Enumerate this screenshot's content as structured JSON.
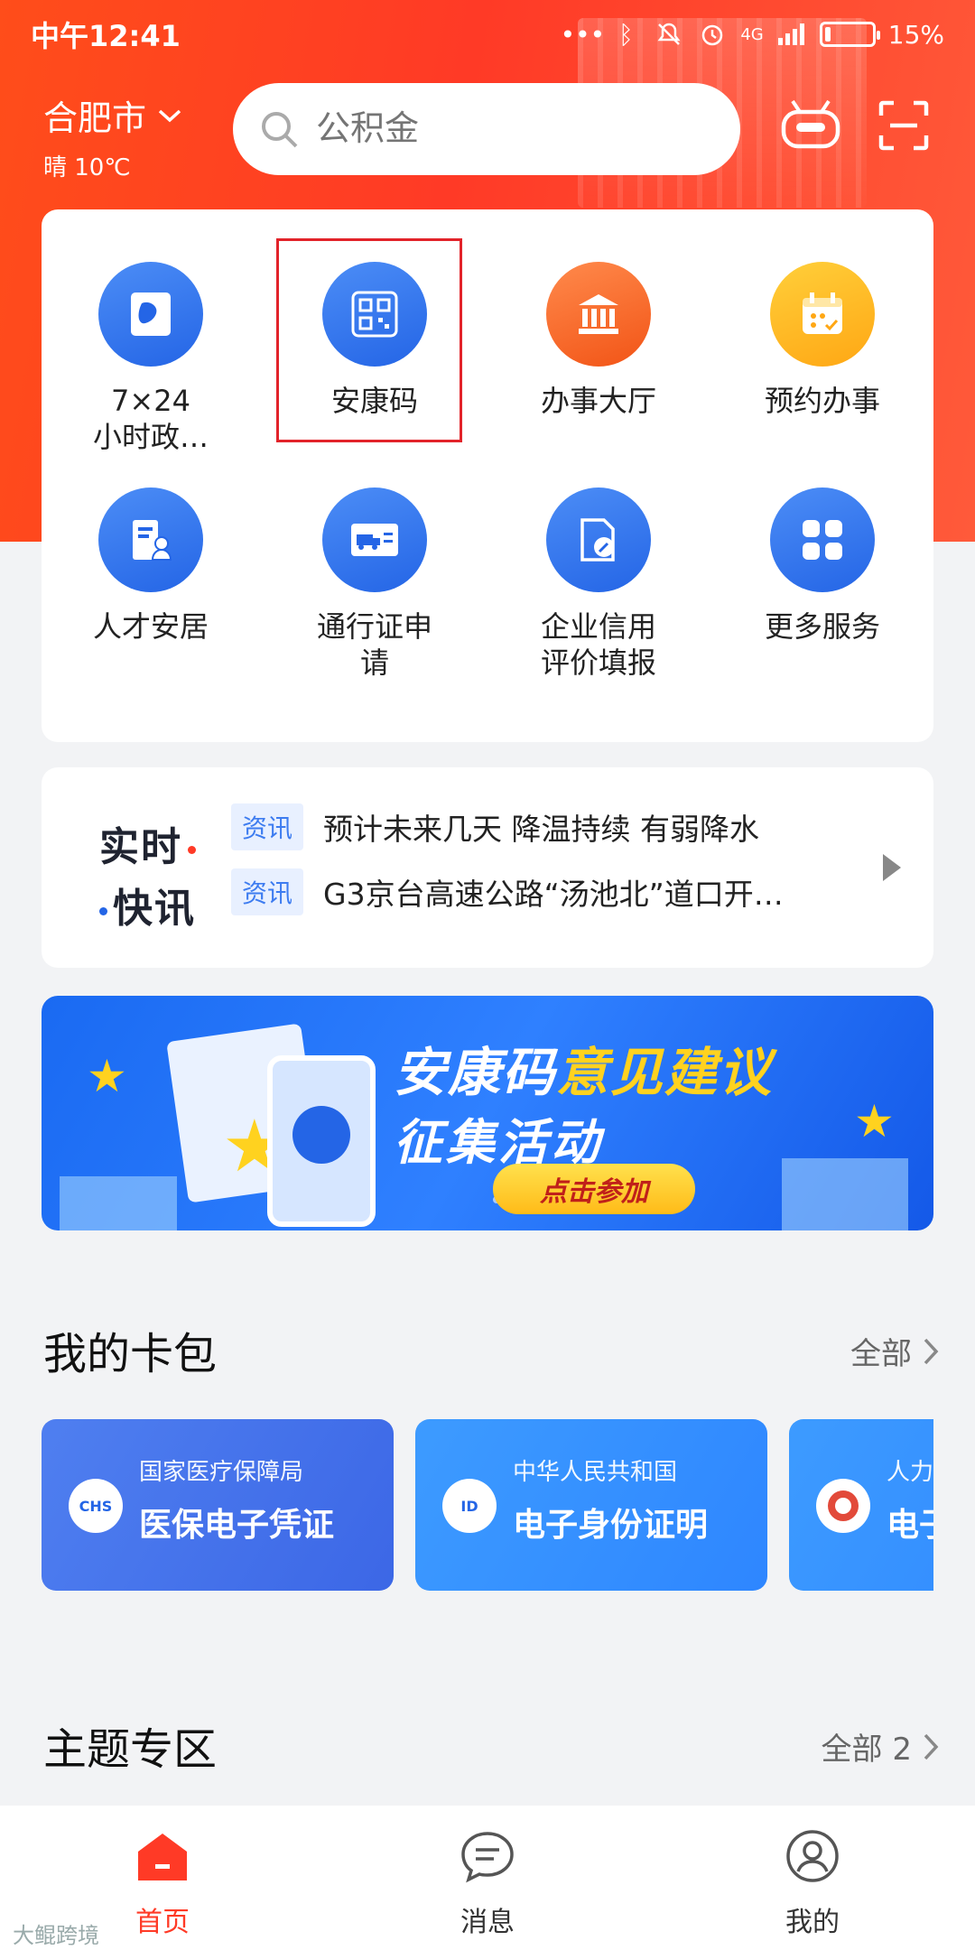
{
  "status_bar": {
    "time": "中午12:41",
    "network": "4G",
    "battery_pct": 15,
    "battery_label": "15%"
  },
  "header": {
    "city": "合肥市",
    "weather": "晴 10℃",
    "search_placeholder": "公积金"
  },
  "services": [
    {
      "label": "7×24\n小时政…",
      "icon": "map-doc-icon",
      "color": "blue"
    },
    {
      "label": "安康码",
      "icon": "qr-code-icon",
      "color": "blue",
      "highlighted": true
    },
    {
      "label": "办事大厅",
      "icon": "government-hall-icon",
      "color": "orange"
    },
    {
      "label": "预约办事",
      "icon": "calendar-icon",
      "color": "yellow"
    },
    {
      "label": "人才安居",
      "icon": "person-doc-icon",
      "color": "blue"
    },
    {
      "label": "通行证申\n请",
      "icon": "truck-pass-icon",
      "color": "blue"
    },
    {
      "label": "企业信用\n评价填报",
      "icon": "edit-doc-icon",
      "color": "blue"
    },
    {
      "label": "更多服务",
      "icon": "grid-icon",
      "color": "blue"
    }
  ],
  "news": {
    "logo_line1": "实时",
    "logo_line2": "快讯",
    "items": [
      {
        "tag": "资讯",
        "text": "预计未来几天 降温持续 有弱降水"
      },
      {
        "tag": "资讯",
        "text": "G3京台高速公路“汤池北”道口开…"
      }
    ]
  },
  "banner": {
    "title_a": "安康码",
    "title_b": "意见建议",
    "subtitle": "征集活动",
    "button": "点击参加"
  },
  "card_wallet": {
    "title": "我的卡包",
    "more": "全部",
    "cards": [
      {
        "issuer": "国家医疗保障局",
        "name": "医保电子凭证",
        "logo_text": "CHS"
      },
      {
        "issuer": "中华人民共和国",
        "name": "电子身份证明",
        "logo_text": "ID"
      },
      {
        "issuer": "人力",
        "name": "电子",
        "logo_text": ""
      }
    ]
  },
  "topics": {
    "title": "主题专区",
    "more": "全部 2"
  },
  "bottom_nav": [
    {
      "label": "首页",
      "icon": "home-icon",
      "active": true
    },
    {
      "label": "消息",
      "icon": "message-icon",
      "active": false
    },
    {
      "label": "我的",
      "icon": "profile-icon",
      "active": false
    }
  ],
  "watermark": "大鲲跨境",
  "colors": {
    "brand_red": "#ff3a26",
    "service_blue": "#2465e6",
    "highlight_border": "#e2232a"
  }
}
